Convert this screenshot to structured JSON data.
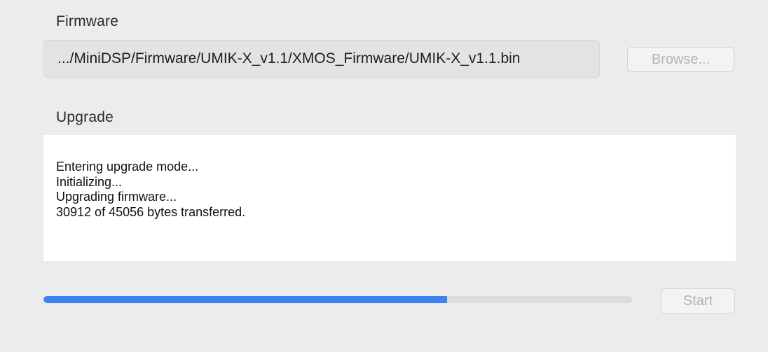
{
  "firmware": {
    "label": "Firmware",
    "path": ".../MiniDSP/Firmware/UMIK-X_v1.1/XMOS_Firmware/UMIK-X_v1.1.bin",
    "browse_label": "Browse..."
  },
  "upgrade": {
    "label": "Upgrade",
    "log_lines": [
      "Entering upgrade mode...",
      "Initializing...",
      "Upgrading firmware...",
      "30912 of 45056 bytes transferred."
    ]
  },
  "progress": {
    "fraction": 0.686,
    "fill_color": "#3b84f0"
  },
  "controls": {
    "start_label": "Start"
  }
}
